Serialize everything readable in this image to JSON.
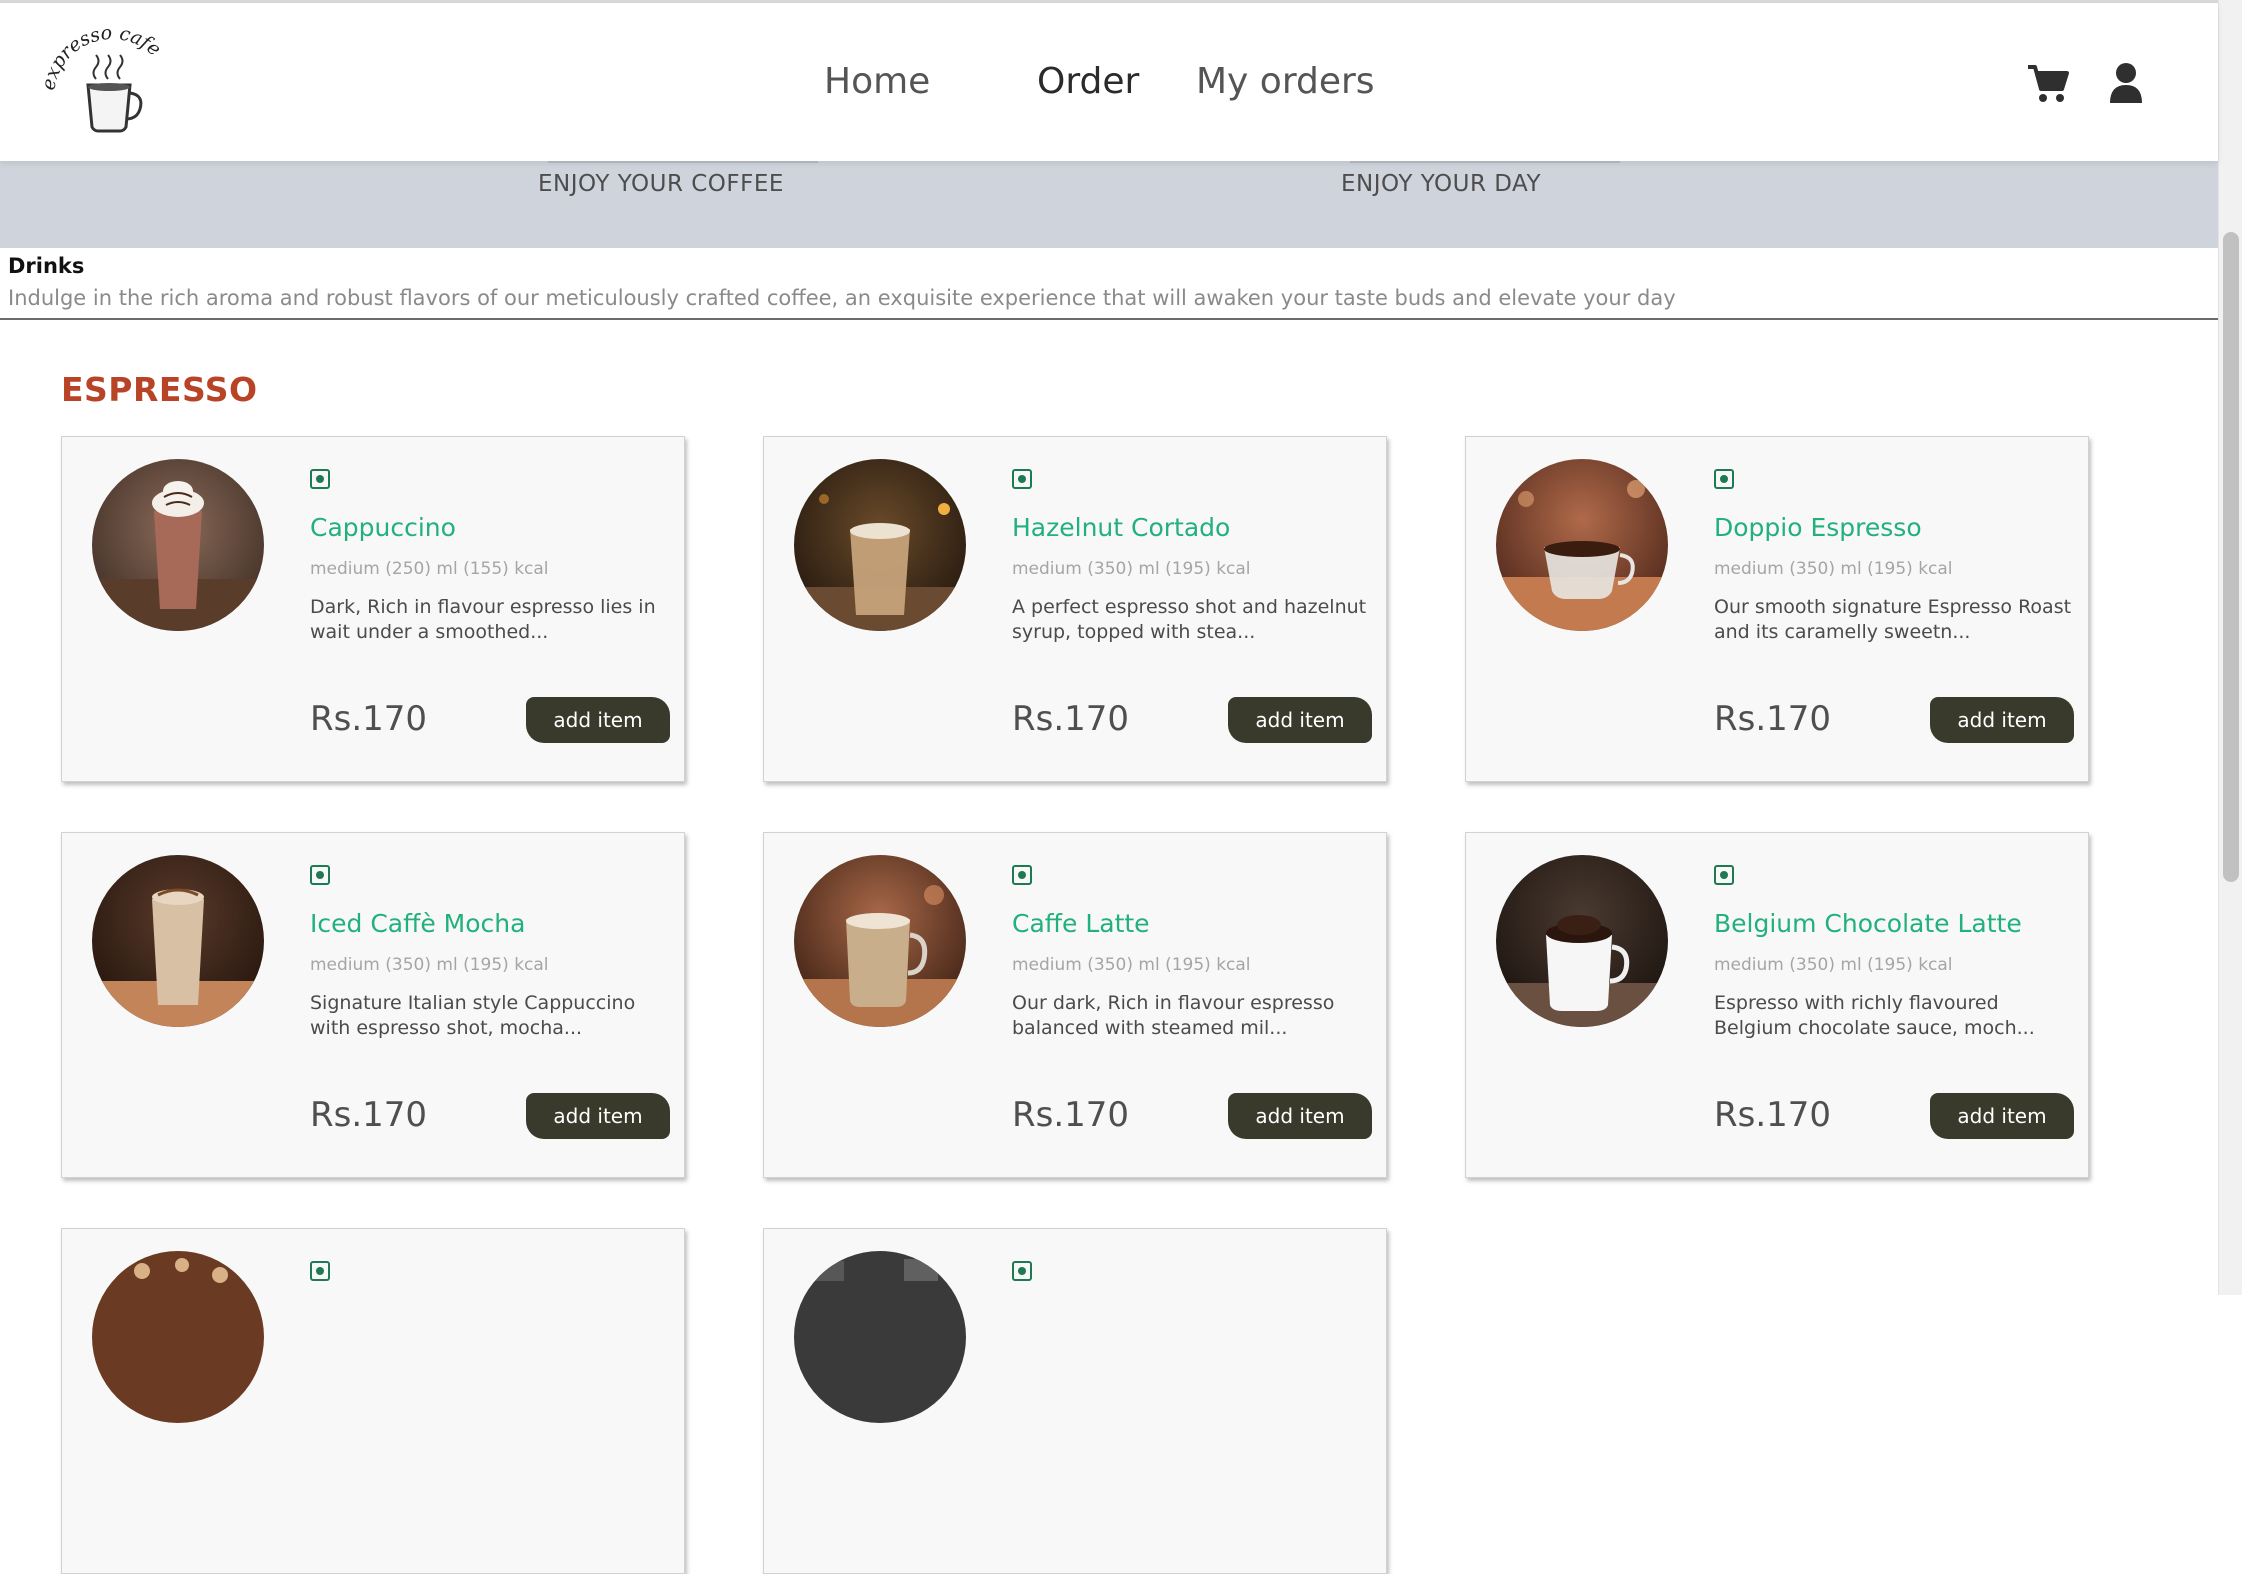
{
  "header": {
    "logo_text": "expresso cafe",
    "nav": {
      "home": "Home",
      "order": "Order",
      "my_orders": "My orders"
    },
    "cart_icon": "cart-icon",
    "user_icon": "user-icon"
  },
  "hero": {
    "tagline_left": "ENJOY YOUR COFFEE",
    "tagline_right": "ENJOY YOUR DAY"
  },
  "drinks": {
    "title": "Drinks",
    "description": "Indulge in the rich aroma and robust flavors of our meticulously crafted coffee, an exquisite experience that will awaken your taste buds and elevate your day"
  },
  "section": {
    "title": "ESPRESSO"
  },
  "colors": {
    "accent_green": "#22b07d",
    "section_red": "#b94326",
    "button_dark": "#3a3a2c"
  },
  "items": [
    {
      "name": "Cappuccino",
      "meta": "medium (250) ml (155) kcal",
      "desc": "Dark, Rich in flavour espresso lies in wait under a smoothed...",
      "price": "Rs.170",
      "button": "add item"
    },
    {
      "name": "Hazelnut Cortado",
      "meta": "medium (350) ml (195) kcal",
      "desc": "A perfect espresso shot and hazelnut syrup, topped with stea...",
      "price": "Rs.170",
      "button": "add item"
    },
    {
      "name": "Doppio Espresso",
      "meta": "medium (350) ml (195) kcal",
      "desc": "Our smooth signature Espresso Roast and its caramelly sweetn...",
      "price": "Rs.170",
      "button": "add item"
    },
    {
      "name": "Iced Caffè Mocha",
      "meta": "medium (350) ml (195) kcal",
      "desc": "Signature Italian style Cappuccino with espresso shot, mocha...",
      "price": "Rs.170",
      "button": "add item"
    },
    {
      "name": "Caffe Latte",
      "meta": "medium (350) ml (195) kcal",
      "desc": "Our dark, Rich in flavour espresso balanced with steamed mil...",
      "price": "Rs.170",
      "button": "add item"
    },
    {
      "name": "Belgium Chocolate Latte",
      "meta": "medium (350) ml (195) kcal",
      "desc": "Espresso with richly flavoured Belgium chocolate sauce, moch...",
      "price": "Rs.170",
      "button": "add item"
    }
  ]
}
